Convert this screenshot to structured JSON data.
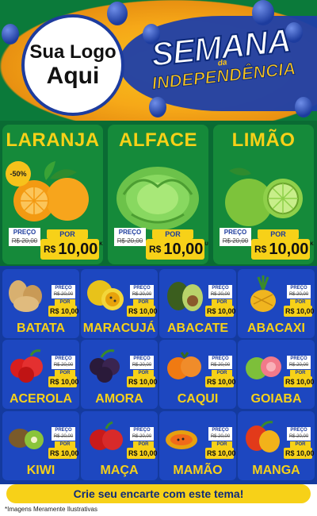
{
  "header": {
    "logo_line1": "Sua Logo",
    "logo_line2": "Aqui",
    "title_main": "SEMANA",
    "title_da": "da",
    "title_sub": "INDEPENDÊNCIA"
  },
  "featured": [
    {
      "name": "LARANJA",
      "badge": "-50%",
      "preco_label": "PREÇO",
      "old_price": "R$ 20,00",
      "por_label": "POR",
      "currency": "R$",
      "price": "10,00",
      "unit": "KG",
      "icon": "orange-icon"
    },
    {
      "name": "ALFACE",
      "preco_label": "PREÇO",
      "old_price": "R$ 20,00",
      "por_label": "POR",
      "currency": "R$",
      "price": "10,00",
      "unit": "UNID",
      "icon": "lettuce-icon"
    },
    {
      "name": "LIMÃO",
      "preco_label": "PREÇO",
      "old_price": "R$ 20,00",
      "por_label": "POR",
      "currency": "R$",
      "price": "10,00",
      "unit": "KG",
      "icon": "lime-icon"
    }
  ],
  "products": [
    {
      "name": "BATATA",
      "preco_label": "PREÇO",
      "old_price": "R$ 20,00",
      "por_label": "POR",
      "price": "R$ 10,00",
      "unit": "KG",
      "icon": "potato-icon"
    },
    {
      "name": "MARACUJÁ",
      "preco_label": "PREÇO",
      "old_price": "R$ 20,00",
      "por_label": "POR",
      "price": "R$ 10,00",
      "unit": "KG",
      "icon": "passionfruit-icon"
    },
    {
      "name": "ABACATE",
      "preco_label": "PREÇO",
      "old_price": "R$ 20,00",
      "por_label": "POR",
      "price": "R$ 10,00",
      "unit": "KG",
      "icon": "avocado-icon"
    },
    {
      "name": "ABACAXI",
      "preco_label": "PREÇO",
      "old_price": "R$ 20,00",
      "por_label": "POR",
      "price": "R$ 10,00",
      "unit": "KG",
      "icon": "pineapple-icon"
    },
    {
      "name": "ACEROLA",
      "preco_label": "PREÇO",
      "old_price": "R$ 20,00",
      "por_label": "POR",
      "price": "R$ 10,00",
      "unit": "KG",
      "icon": "acerola-icon"
    },
    {
      "name": "AMORA",
      "preco_label": "PREÇO",
      "old_price": "R$ 20,00",
      "por_label": "POR",
      "price": "R$ 10,00",
      "unit": "KG",
      "icon": "blackberry-icon"
    },
    {
      "name": "CAQUI",
      "preco_label": "PREÇO",
      "old_price": "R$ 20,00",
      "por_label": "POR",
      "price": "R$ 10,00",
      "unit": "KG",
      "icon": "persimmon-icon"
    },
    {
      "name": "GOIABA",
      "preco_label": "PREÇO",
      "old_price": "R$ 20,00",
      "por_label": "POR",
      "price": "R$ 10,00",
      "unit": "KG",
      "icon": "guava-icon"
    },
    {
      "name": "KIWI",
      "preco_label": "PREÇO",
      "old_price": "R$ 20,00",
      "por_label": "POR",
      "price": "R$ 10,00",
      "unit": "KG",
      "icon": "kiwi-icon"
    },
    {
      "name": "MAÇA",
      "preco_label": "PREÇO",
      "old_price": "R$ 20,00",
      "por_label": "POR",
      "price": "R$ 10,00",
      "unit": "KG",
      "icon": "apple-icon"
    },
    {
      "name": "MAMÃO",
      "preco_label": "PREÇO",
      "old_price": "R$ 20,00",
      "por_label": "POR",
      "price": "R$ 10,00",
      "unit": "KG",
      "icon": "papaya-icon"
    },
    {
      "name": "MANGA",
      "preco_label": "PREÇO",
      "old_price": "R$ 20,00",
      "por_label": "POR",
      "price": "R$ 10,00",
      "unit": "KG",
      "icon": "mango-icon"
    }
  ],
  "cta": "Crie seu encarte com este tema!",
  "footnote": "*Imagens Meramente Ilustrativas",
  "colors": {
    "green": "#0a6b33",
    "blue": "#143a9e",
    "yellow": "#f7d118"
  }
}
